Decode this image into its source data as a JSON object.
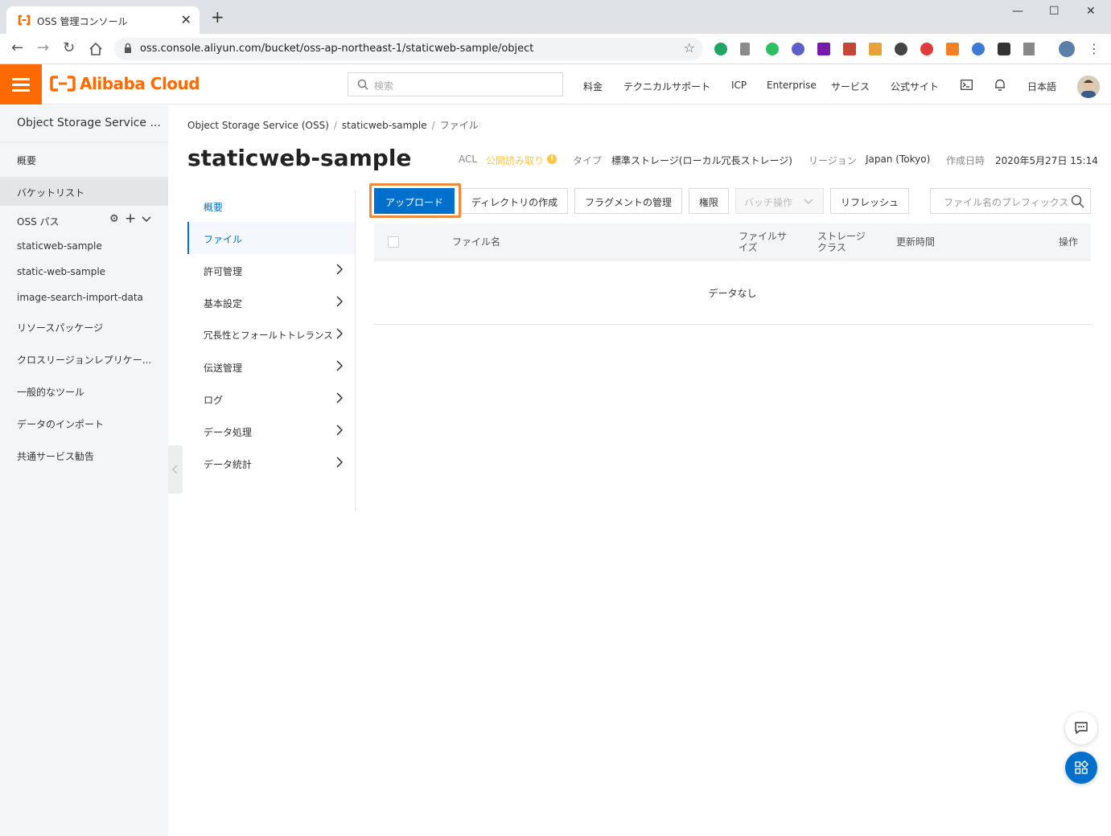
{
  "browser": {
    "tab_title": "OSS 管理コンソール",
    "url": "oss.console.aliyun.com/bucket/oss-ap-northeast-1/staticweb-sample/object"
  },
  "header": {
    "logo": "Alibaba Cloud",
    "search_placeholder": "検索",
    "nav": [
      "料金",
      "テクニカルサポート",
      "ICP",
      "Enterprise",
      "サービス",
      "公式サイト",
      "日本語"
    ]
  },
  "sidebar": {
    "title": "Object Storage Service ...",
    "items": [
      "概要",
      "バケットリスト",
      "OSS パス",
      "staticweb-sample",
      "static-web-sample",
      "image-search-import-data",
      "リソースパッケージ",
      "クロスリージョンレプリケー...",
      "一般的なツール",
      "データのインポート",
      "共通サービス勧告"
    ]
  },
  "breadcrumb": {
    "root": "Object Storage Service (OSS)",
    "bucket": "staticweb-sample",
    "current": "ファイル"
  },
  "bucket": {
    "name": "staticweb-sample",
    "acl_label": "ACL",
    "acl_value": "公開読み取り",
    "type_label": "タイプ",
    "type_value": "標準ストレージ(ローカル冗長ストレージ)",
    "region_label": "リージョン",
    "region_value": "Japan (Tokyo)",
    "created_label": "作成日時",
    "created_value": "2020年5月27日 15:14"
  },
  "submenu": [
    "概要",
    "ファイル",
    "許可管理",
    "基本設定",
    "冗長性とフォールトトレランス",
    "伝送管理",
    "ログ",
    "データ処理",
    "データ統計"
  ],
  "actions": {
    "upload": "アップロード",
    "mkdir": "ディレクトリの作成",
    "fragment": "フラグメントの管理",
    "permission": "権限",
    "batch": "バッチ操作",
    "refresh": "リフレッシュ",
    "prefix_placeholder": "ファイル名のプレフィックス"
  },
  "table": {
    "col_name": "ファイル名",
    "col_size_1": "ファイルサ",
    "col_size_2": "イズ",
    "col_class_1": "ストレージ",
    "col_class_2": "クラス",
    "col_updated": "更新時間",
    "col_ops": "操作",
    "empty": "データなし"
  }
}
